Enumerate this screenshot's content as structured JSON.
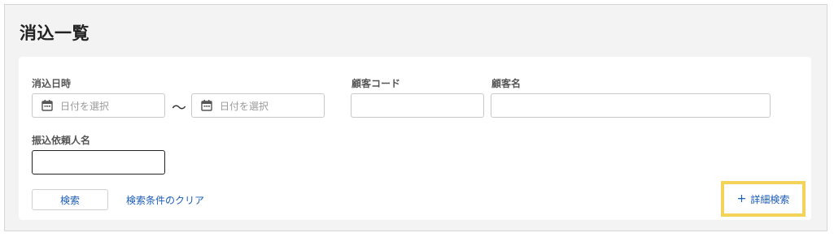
{
  "page": {
    "title": "消込一覧"
  },
  "filters": {
    "reconcile_date": {
      "label": "消込日時",
      "from_placeholder": "日付を選択",
      "separator": "〜",
      "to_placeholder": "日付を選択"
    },
    "customer_code": {
      "label": "顧客コード",
      "value": ""
    },
    "customer_name": {
      "label": "顧客名",
      "value": ""
    },
    "remitter_name": {
      "label": "振込依頼人名",
      "value": ""
    }
  },
  "actions": {
    "search_label": "検索",
    "clear_label": "検索条件のクリア",
    "advanced_plus": "+",
    "advanced_label": "詳細検索"
  },
  "icons": {
    "calendar": "calendar-icon",
    "plus": "plus-icon"
  },
  "colors": {
    "link": "#1a5bb5",
    "highlight": "#f3d35a",
    "background": "#f3f3f3"
  }
}
